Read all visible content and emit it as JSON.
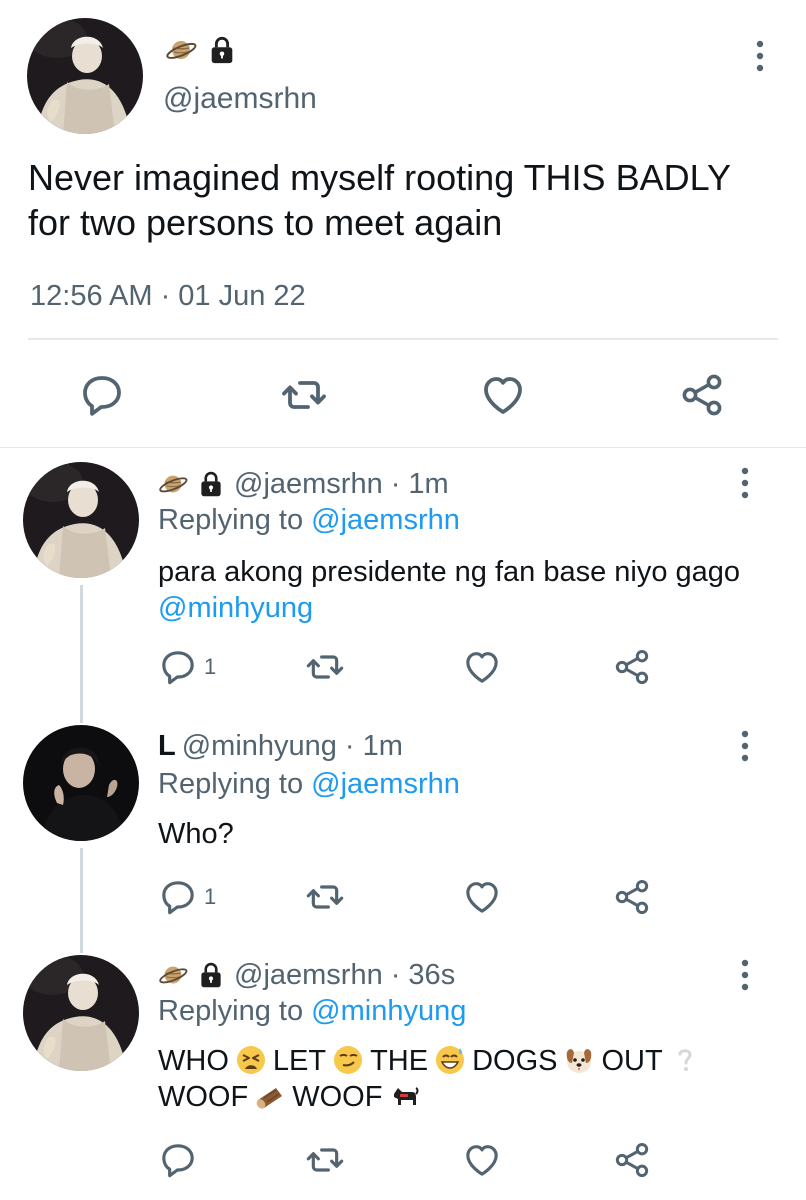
{
  "main_tweet": {
    "handle": "@jaemsrhn",
    "text": "Never imagined myself rooting THIS BADLY for two persons to meet again",
    "timestamp": "12:56 AM · 01 Jun 22",
    "name_icons": [
      "ringed-planet-icon",
      "lock-icon"
    ],
    "actions": [
      "reply-icon",
      "retweet-icon",
      "like-icon",
      "share-icon"
    ]
  },
  "replies": [
    {
      "name": "",
      "name_icons": [
        "ringed-planet-icon",
        "lock-icon"
      ],
      "handle": "@jaemsrhn",
      "time": "· 1m",
      "replying_prefix": "Replying to",
      "replying_to": "@jaemsrhn",
      "body_text": "para akong presidente ng fan base niyo gago",
      "body_mention": "@minhyung",
      "reply_count": "1"
    },
    {
      "name": "L",
      "handle": "@minhyung",
      "time": "· 1m",
      "replying_prefix": "Replying to",
      "replying_to": "@jaemsrhn",
      "body_text": "Who?",
      "reply_count": "1"
    },
    {
      "name": "",
      "name_icons": [
        "ringed-planet-icon",
        "lock-icon"
      ],
      "handle": "@jaemsrhn",
      "time": "· 36s",
      "replying_prefix": "Replying to",
      "replying_to": "@minhyung",
      "words": [
        "WHO",
        "LET",
        "THE",
        "DOGS",
        "OUT",
        "WOOF",
        "WOOF"
      ],
      "emojis": [
        "tired-face-emoji",
        "smirk-emoji",
        "sweat-smile-emoji",
        "dog-face-emoji",
        "question-mark-emoji",
        "log-emoji",
        "black-dog-emoji"
      ],
      "reply_count": ""
    }
  ],
  "colors": {
    "text": "#0f1419",
    "secondary": "#536471",
    "link": "#1d9bf0",
    "divider": "#e6e9ec",
    "thread_line": "#cfd9de"
  }
}
